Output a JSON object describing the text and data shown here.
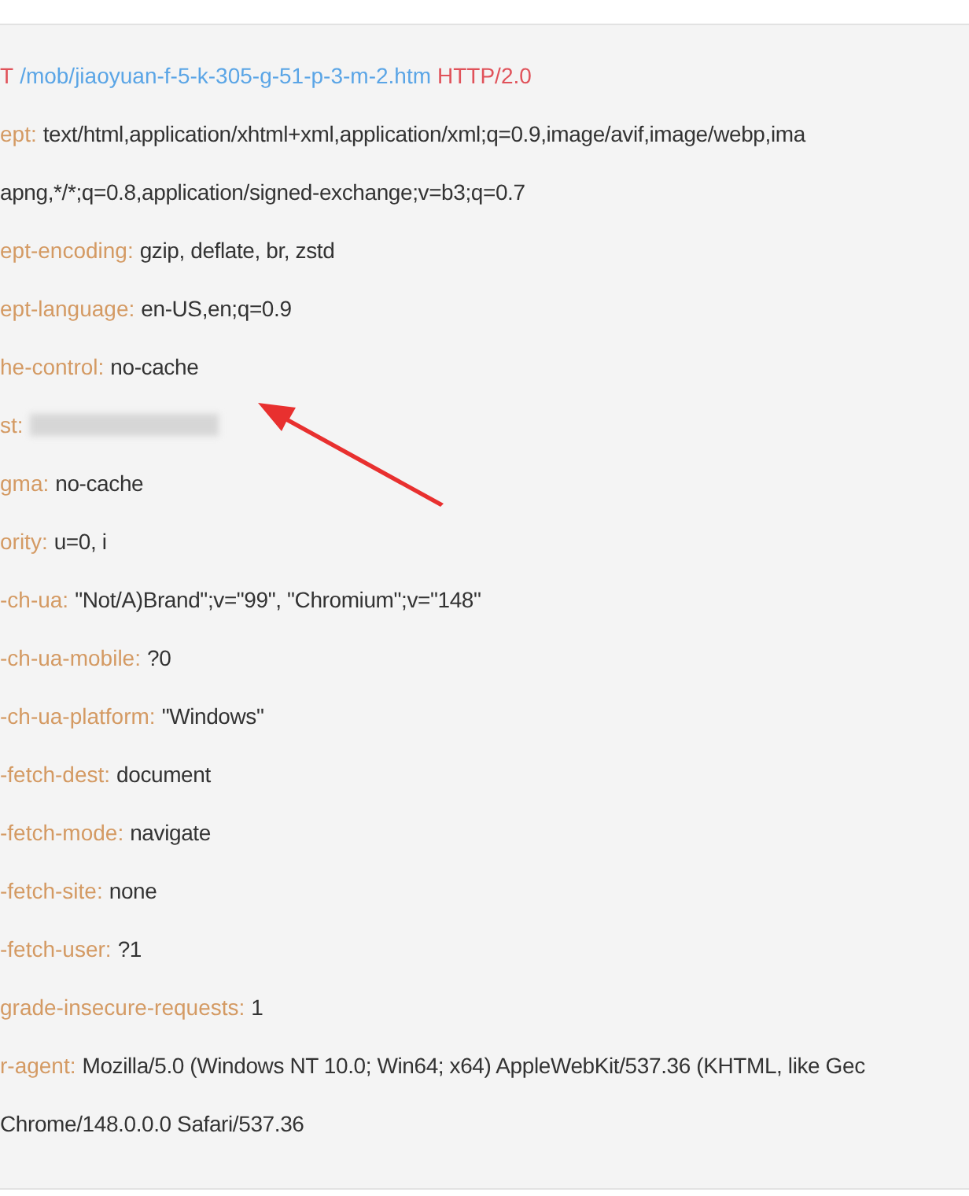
{
  "request_line": {
    "method": "T",
    "path": "/mob/jiaoyuan-f-5-k-305-g-51-p-3-m-2.htm",
    "protocol": "HTTP/2.0"
  },
  "headers": [
    {
      "kind": "text",
      "name": "ept:",
      "value": [
        "text/html,application/xhtml+xml,application/xml;q=0.9,image/avif,image/webp,ima",
        "apng,*/*;q=0.8,application/signed-exchange;v=b3;q=0.7"
      ]
    },
    {
      "kind": "text",
      "name": "ept-encoding:",
      "value": [
        "gzip, deflate, br, zstd"
      ]
    },
    {
      "kind": "text",
      "name": "ept-language:",
      "value": [
        "en-US,en;q=0.9"
      ]
    },
    {
      "kind": "text",
      "name": "he-control:",
      "value": [
        "no-cache"
      ]
    },
    {
      "kind": "redacted",
      "name": "st:"
    },
    {
      "kind": "text",
      "name": "gma:",
      "value": [
        "no-cache"
      ]
    },
    {
      "kind": "text",
      "name": "ority:",
      "value": [
        "u=0, i"
      ]
    },
    {
      "kind": "text",
      "name": "-ch-ua:",
      "value": [
        "\"Not/A)Brand\";v=\"99\", \"Chromium\";v=\"148\""
      ]
    },
    {
      "kind": "text",
      "name": "-ch-ua-mobile:",
      "value": [
        "?0"
      ]
    },
    {
      "kind": "text",
      "name": "-ch-ua-platform:",
      "value": [
        "\"Windows\""
      ]
    },
    {
      "kind": "text",
      "name": "-fetch-dest:",
      "value": [
        "document"
      ]
    },
    {
      "kind": "text",
      "name": "-fetch-mode:",
      "value": [
        "navigate"
      ]
    },
    {
      "kind": "text",
      "name": "-fetch-site:",
      "value": [
        "none"
      ]
    },
    {
      "kind": "text",
      "name": "-fetch-user:",
      "value": [
        "?1"
      ]
    },
    {
      "kind": "text",
      "name": "grade-insecure-requests:",
      "value": [
        "1"
      ]
    },
    {
      "kind": "text",
      "name": "r-agent:",
      "value": [
        "Mozilla/5.0 (Windows NT 10.0; Win64; x64) AppleWebKit/537.36 (KHTML, like Gec",
        "Chrome/148.0.0.0 Safari/537.36"
      ]
    }
  ]
}
